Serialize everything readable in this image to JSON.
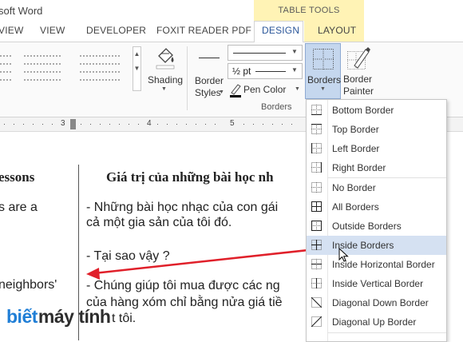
{
  "window": {
    "title": "soft Word"
  },
  "table_tools_label": "TABLE TOOLS",
  "tabs": [
    {
      "label": "VIEW"
    },
    {
      "label": "VIEW"
    },
    {
      "label": "DEVELOPER"
    },
    {
      "label": "FOXIT READER PDF"
    },
    {
      "label": "DESIGN"
    },
    {
      "label": "LAYOUT"
    }
  ],
  "ribbon": {
    "shading_label": "Shading",
    "border_styles_label": "Border Styles",
    "pen_weight": "½ pt",
    "pen_color_label": "Pen Color",
    "borders_label": "Borders",
    "border_painter_label": "Border Painter",
    "group_label": "Borders"
  },
  "ruler": {
    "marks": [
      "3",
      "4",
      "5"
    ]
  },
  "document": {
    "left_col": [
      "essons",
      "s are a",
      "neighbors'"
    ],
    "header": "Giá trị của những bài học nh",
    "lines": [
      "- Những bài học nhạc của con gái",
      "cả một gia sản của tôi đó.",
      "- Tại sao vậy ?",
      "- Chúng giúp tôi mua được các ng",
      "của hàng xóm chỉ bằng nửa giá tiề",
      "t tôi."
    ]
  },
  "borders_menu": {
    "items": [
      {
        "label": "Bottom Border",
        "icon": "bottom-border-icon"
      },
      {
        "label": "Top Border",
        "icon": "top-border-icon"
      },
      {
        "label": "Left Border",
        "icon": "left-border-icon"
      },
      {
        "label": "Right Border",
        "icon": "right-border-icon"
      },
      {
        "label": "No Border",
        "icon": "no-border-icon"
      },
      {
        "label": "All Borders",
        "icon": "all-borders-icon"
      },
      {
        "label": "Outside Borders",
        "icon": "outside-borders-icon"
      },
      {
        "label": "Inside Borders",
        "icon": "inside-borders-icon",
        "highlighted": true
      },
      {
        "label": "Inside Horizontal Border",
        "icon": "inside-horizontal-border-icon"
      },
      {
        "label": "Inside Vertical Border",
        "icon": "inside-vertical-border-icon"
      },
      {
        "label": "Diagonal Down Border",
        "icon": "diagonal-down-border-icon"
      },
      {
        "label": "Diagonal Up Border",
        "icon": "diagonal-up-border-icon"
      }
    ]
  },
  "watermark": {
    "part1": "biết",
    "part2": "máy tính"
  },
  "colors": {
    "accent_blue": "#2b579a",
    "highlight": "#d5e1f2",
    "tab_tools_bg": "#fff3b5",
    "arrow_red": "#e0202a"
  }
}
